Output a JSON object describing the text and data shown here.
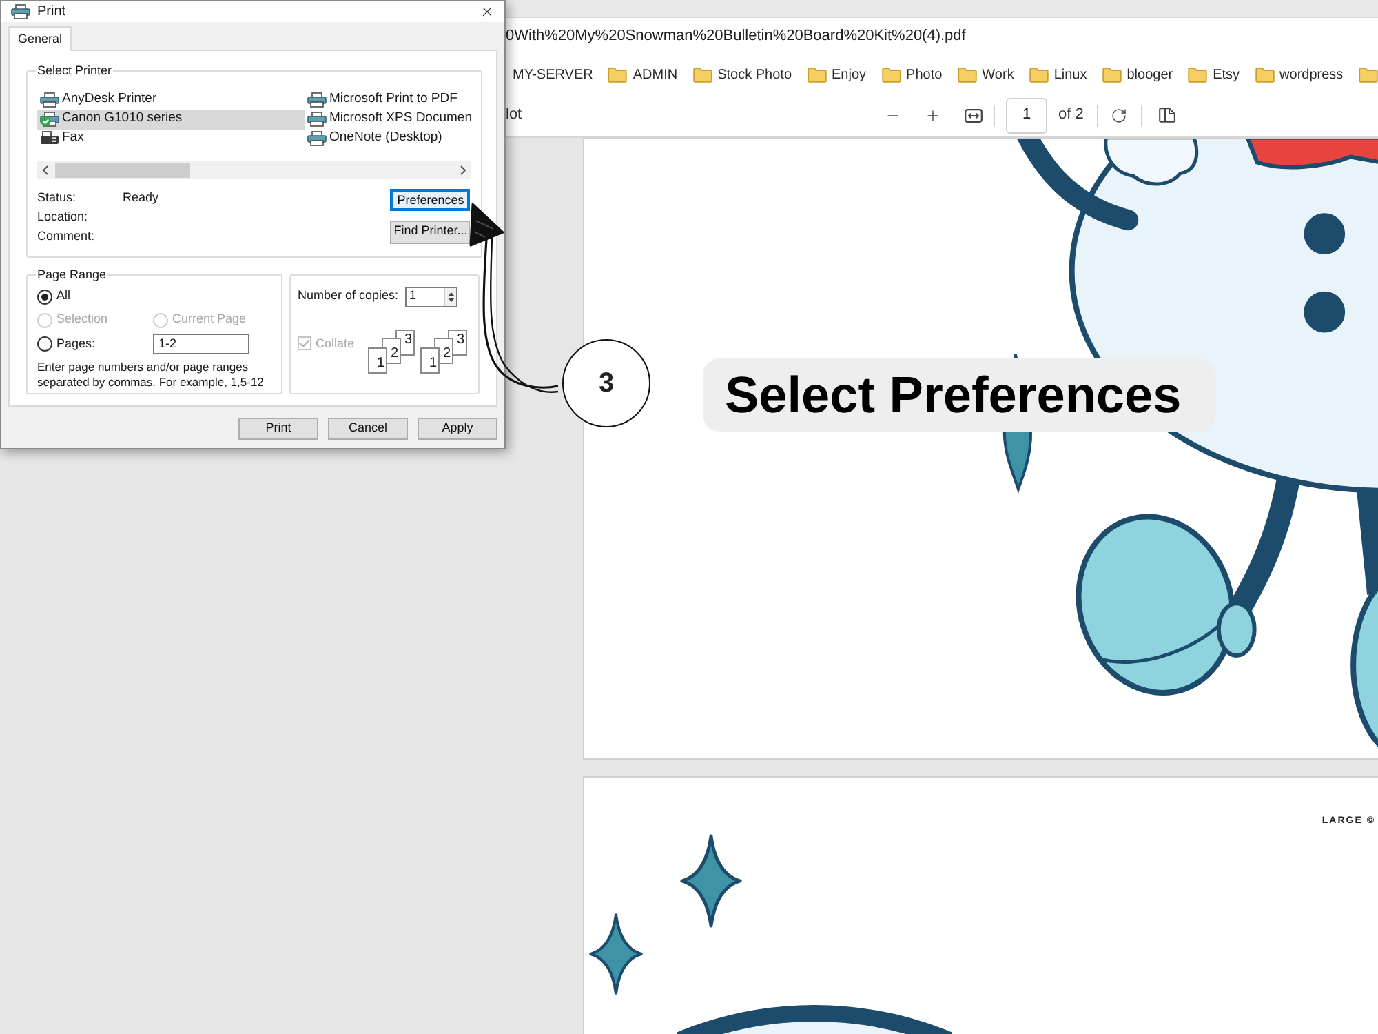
{
  "browser": {
    "address_bar": {
      "url": "0With%20My%20Snowman%20Bulletin%20Board%20Kit%20(4).pdf"
    },
    "bookmarks": [
      {
        "kind": "site",
        "label": "MY-SERVER"
      },
      {
        "kind": "folder",
        "label": "ADMIN"
      },
      {
        "kind": "folder",
        "label": "Stock Photo"
      },
      {
        "kind": "folder",
        "label": "Enjoy"
      },
      {
        "kind": "folder",
        "label": "Photo"
      },
      {
        "kind": "folder",
        "label": "Work"
      },
      {
        "kind": "folder",
        "label": "Linux"
      },
      {
        "kind": "folder",
        "label": "blooger"
      },
      {
        "kind": "folder",
        "label": "Etsy"
      },
      {
        "kind": "folder",
        "label": "wordpress"
      },
      {
        "kind": "folder"
      }
    ],
    "pdf_toolbar": {
      "title": "lot",
      "page": "1",
      "page_count": "of 2"
    }
  },
  "pdf_pages": [
    {
      "kind": "snowman_body"
    },
    {
      "kind": "snowman_head",
      "label": "LARGE ©"
    }
  ],
  "print_dialog": {
    "title": "Print",
    "tabs": [
      {
        "label": "General",
        "selected": true
      }
    ],
    "select_printer": {
      "legend": "Select Printer",
      "printers": [
        {
          "name": "AnyDesk Printer",
          "kind": "printer",
          "selected": false,
          "default": false
        },
        {
          "name": "Canon G1010 series",
          "kind": "printer",
          "selected": true,
          "default": true
        },
        {
          "name": "Fax",
          "kind": "fax",
          "selected": false,
          "default": false
        },
        {
          "name": "Microsoft Print to PDF",
          "kind": "printer",
          "selected": false,
          "default": false
        },
        {
          "name": "Microsoft XPS Documen",
          "kind": "printer",
          "selected": false,
          "default": false
        },
        {
          "name": "OneNote (Desktop)",
          "kind": "printer",
          "selected": false,
          "default": false
        }
      ],
      "info": [
        {
          "label": "Status:",
          "value": "Ready"
        },
        {
          "label": "Location:"
        },
        {
          "label": "Comment:"
        }
      ],
      "buttons": [
        {
          "label": "Preferences",
          "focused": true
        },
        {
          "label": "Find Printer...",
          "focused": false
        }
      ]
    },
    "page_range": {
      "legend": "Page Range",
      "options": [
        {
          "label": "All",
          "selected": true,
          "disabled": false
        },
        {
          "label": "Selection",
          "selected": false,
          "disabled": true
        },
        {
          "label": "Current Page",
          "selected": false,
          "disabled": true
        },
        {
          "label": "Pages:",
          "selected": false,
          "disabled": false
        }
      ],
      "pages_value": "1-2",
      "hint": "Enter page numbers and/or page ranges separated by commas. For example, 1,5-12"
    },
    "copies": {
      "label": "Number of copies:",
      "value": "1",
      "collate": {
        "label": "Collate",
        "checked": true,
        "disabled": true
      },
      "collate_stacks": [
        [
          "1",
          "2",
          "3"
        ],
        [
          "1",
          "2",
          "3"
        ]
      ]
    },
    "footer_buttons": [
      "Print",
      "Cancel",
      "Apply"
    ]
  },
  "annotation": {
    "step": "3",
    "caption": "Select Preferences"
  }
}
